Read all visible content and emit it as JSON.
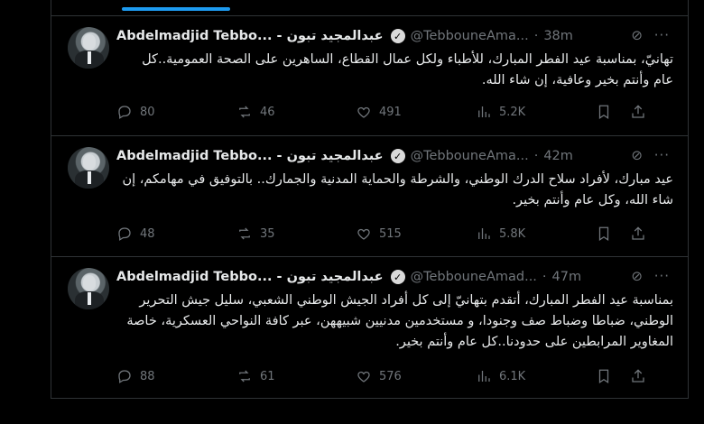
{
  "tweets": [
    {
      "name": "Abdelmadjid Tebbo... - عبدالمجيد تبون",
      "handle": "@TebbouneAma...",
      "time": "38m",
      "text": "تهانيّ، بمناسبة عيد الفطر المبارك، للأطباء ولكل عمال القطاع، الساهرين على الصحة العمومية..كل عام وأنتم بخير وعافية، إن شاء الله.",
      "replies": "80",
      "reposts": "46",
      "likes": "491",
      "views": "5.2K"
    },
    {
      "name": "Abdelmadjid Tebbo... - عبدالمجيد تبون",
      "handle": "@TebbouneAma...",
      "time": "42m",
      "text": "عيد مبارك، لأفراد سلاح الدرك الوطني، والشرطة والحماية المدنية والجمارك.. بالتوفيق في مهامكم، إن شاء الله، وكل عام وأنتم بخير.",
      "replies": "48",
      "reposts": "35",
      "likes": "515",
      "views": "5.8K"
    },
    {
      "name": "Abdelmadjid Tebbo... - عبدالمجيد تبون",
      "handle": "@TebbouneAmad...",
      "time": "47m",
      "text": "بمناسبة عيد الفطر المبارك، أتقدم بتهانيّ إلى كل أفراد الجيش الوطني الشعبي، سليل جيش التحرير الوطني، ضباطا وضباط صف وجنودا، و مستخدمين مدنيين شبيههن، عبر كافة النواحي العسكرية، خاصة المغاوير المرابطين على حدودنا..كل عام وأنتم بخير.",
      "replies": "88",
      "reposts": "61",
      "likes": "576",
      "views": "6.1K"
    }
  ],
  "icons": {
    "verified": "verified-badge-icon",
    "grok": "grok-icon",
    "more": "more-icon",
    "reply": "reply-icon",
    "repost": "repost-icon",
    "like": "like-icon",
    "views": "views-icon",
    "bookmark": "bookmark-icon",
    "share": "share-icon"
  },
  "colors": {
    "background": "#000000",
    "text": "#e7e9ea",
    "muted": "#71767b",
    "accent": "#1d9bf0",
    "divider": "#2f3336"
  }
}
